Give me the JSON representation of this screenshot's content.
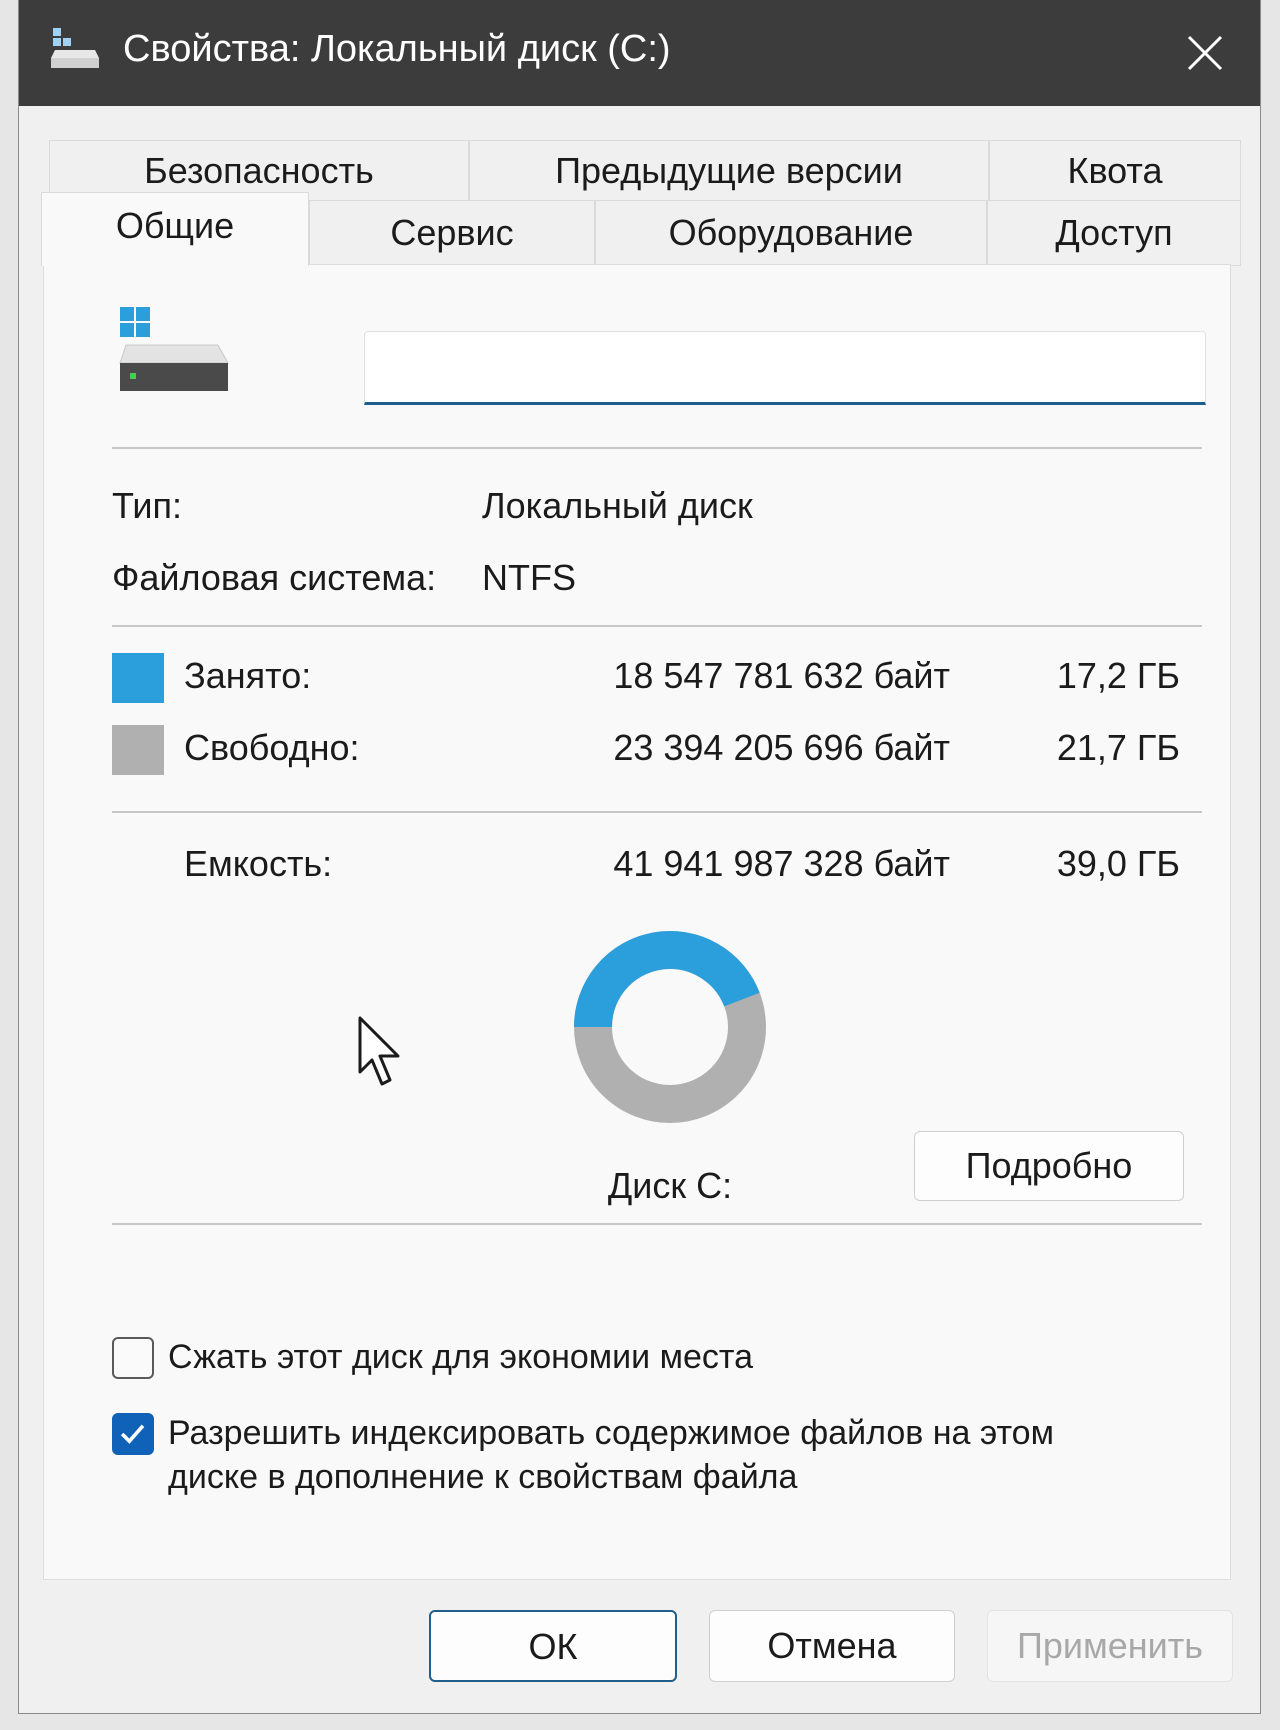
{
  "window": {
    "title": "Свойства: Локальный диск (C:)",
    "title_icon": "drive-icon",
    "close_icon": "close-icon"
  },
  "tabs": {
    "back_row": [
      "Безопасность",
      "Предыдущие версии",
      "Квота"
    ],
    "front_row": [
      "Общие",
      "Сервис",
      "Оборудование",
      "Доступ"
    ],
    "active": "Общие"
  },
  "general": {
    "drive_name_value": "",
    "type_label": "Тип:",
    "type_value": "Локальный диск",
    "fs_label": "Файловая система:",
    "fs_value": "NTFS",
    "used_label": "Занято:",
    "used_bytes": "18 547 781 632 байт",
    "used_gb": "17,2 ГБ",
    "free_label": "Свободно:",
    "free_bytes": "23 394 205 696 байт",
    "free_gb": "21,7 ГБ",
    "capacity_label": "Емкость:",
    "capacity_bytes": "41 941 987 328 байт",
    "capacity_gb": "39,0 ГБ",
    "disk_label": "Диск C:",
    "details_button": "Подробно",
    "used_fraction": 0.442,
    "used_color": "#2b9fdb",
    "free_color": "#b0b0b0"
  },
  "options": {
    "compress_label": "Сжать этот диск для экономии места",
    "compress_checked": false,
    "index_label_line1": "Разрешить индексировать содержимое файлов на этом",
    "index_label_line2": "диске в дополнение к свойствам файла",
    "index_checked": true
  },
  "footer": {
    "ok": "ОК",
    "cancel": "Отмена",
    "apply": "Применить"
  }
}
